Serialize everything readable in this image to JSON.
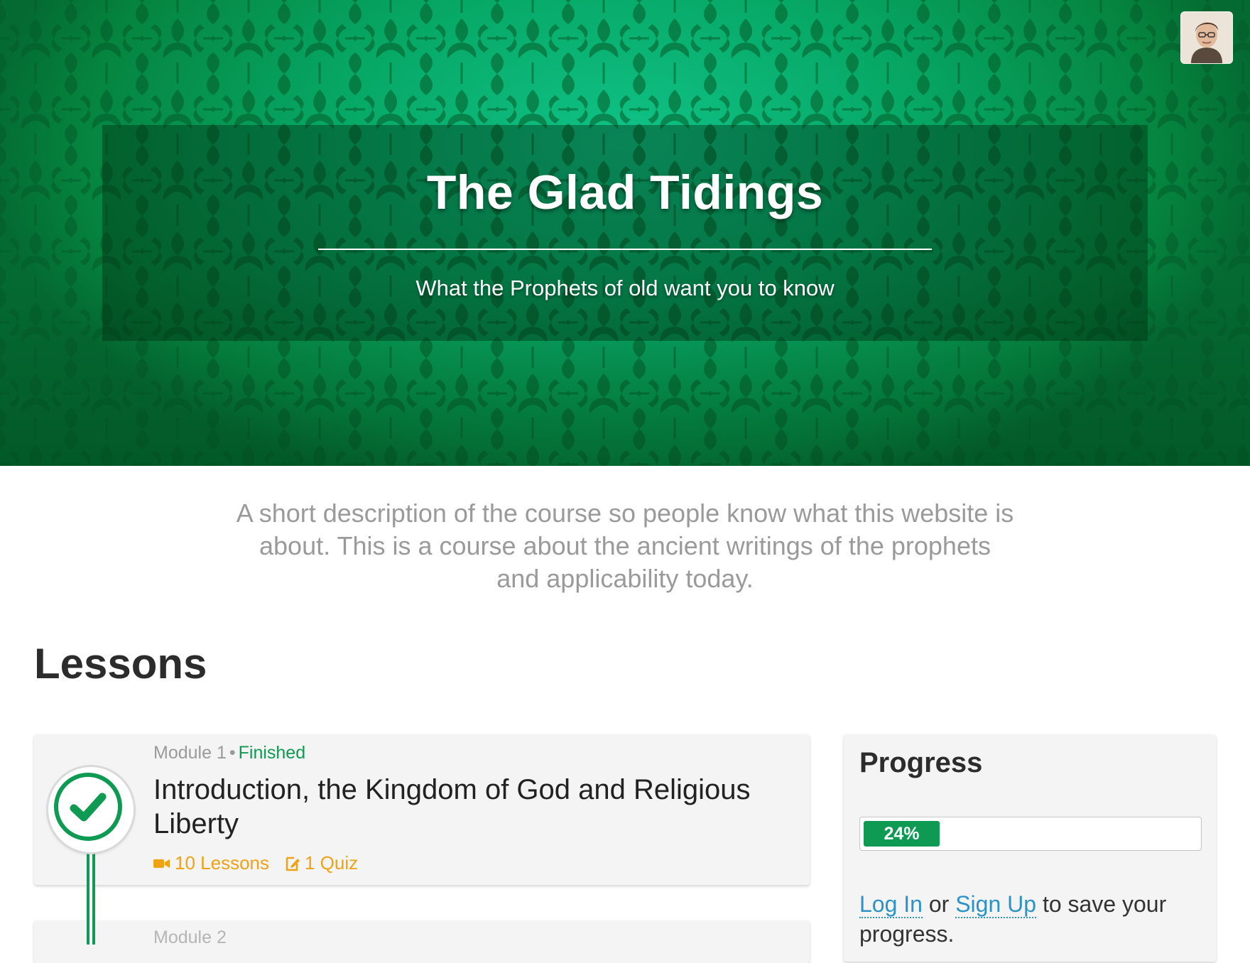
{
  "hero": {
    "title": "The Glad Tidings",
    "subtitle": "What the Prophets of old want you to know",
    "background_color": "#07a866"
  },
  "user": {
    "avatar_icon": "user-avatar"
  },
  "description": "A short description of the course so people know what this website is about. This is a course about the ancient writings of the prophets and applicability today.",
  "lessons": {
    "heading": "Lessons",
    "modules": [
      {
        "meta": "Module 1",
        "separator": "•",
        "status": "Finished",
        "title": "Introduction, the Kingdom of God and Religious Liberty",
        "lessons_count": "10 Lessons",
        "quiz_count": "1 Quiz",
        "lessons_icon": "video-camera-icon",
        "quiz_icon": "quiz-edit-icon",
        "completed": true
      },
      {
        "meta": "Module 2"
      }
    ]
  },
  "progress": {
    "title": "Progress",
    "percent_label": "24%",
    "percent_value": 0.24,
    "login_label": "Log In",
    "or_text": "or",
    "signup_label": "Sign Up",
    "save_text": "to save your progress."
  },
  "colors": {
    "accent_green": "#0e9a52",
    "link_blue": "#2b93c7",
    "stat_orange": "#f0a215"
  }
}
